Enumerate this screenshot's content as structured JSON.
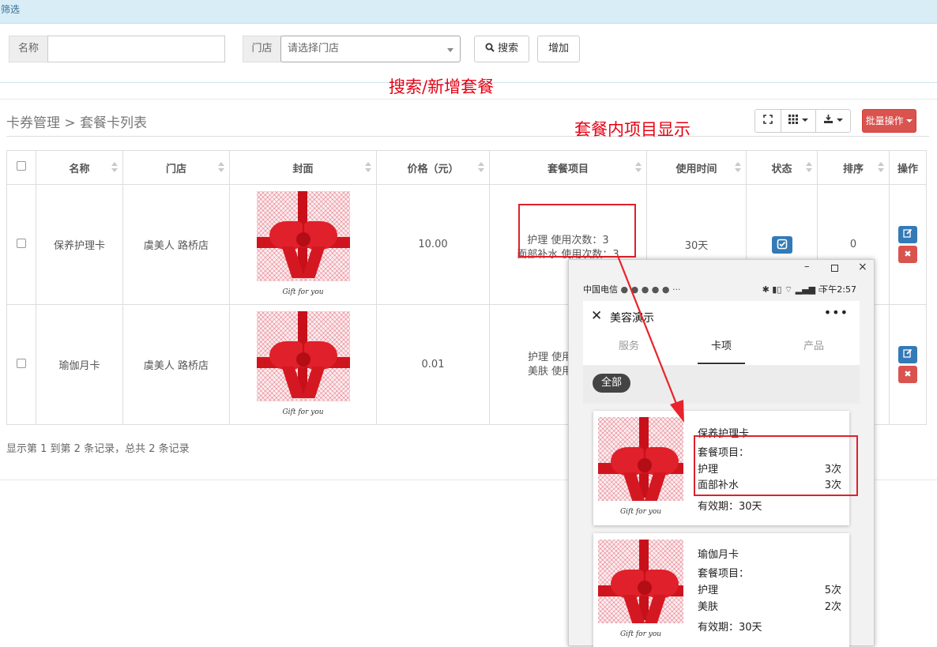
{
  "filter": {
    "title": "筛选",
    "name_label": "名称",
    "name_value": "",
    "store_label": "门店",
    "store_placeholder": "请选择门店",
    "search_label": "搜索",
    "add_label": "增加"
  },
  "annotations": {
    "search_note": "搜索/新增套餐",
    "items_note": "套餐内项目显示"
  },
  "breadcrumb": {
    "parent": "卡券管理",
    "separator": ">",
    "current": "套餐卡列表"
  },
  "toolbar": {
    "batch_label": "批量操作"
  },
  "table": {
    "headers": [
      "名称",
      "门店",
      "封面",
      "价格（元）",
      "套餐项目",
      "使用时间",
      "状态",
      "排序",
      "操作"
    ],
    "rows": [
      {
        "name": "保养护理卡",
        "store": "虞美人 路桥店",
        "cover_text": "Gift for you",
        "price": "10.00",
        "items": [
          "护理 使用次数：3",
          "面部补水 使用次数：3"
        ],
        "duration": "30天",
        "status": "checked",
        "sort": "0"
      },
      {
        "name": "瑜伽月卡",
        "store": "虞美人 路桥店",
        "cover_text": "Gift for you",
        "price": "0.01",
        "items": [
          "护理 使用",
          "美肤 使用"
        ],
        "duration": "",
        "status": "",
        "sort": ""
      }
    ],
    "footer": "显示第 1 到第 2 条记录，总共 2 条记录"
  },
  "phone": {
    "carrier": "中国电信",
    "time": "下午2:57",
    "title": "美容演示",
    "tabs": [
      "服务",
      "卡项",
      "产品"
    ],
    "active_tab": "卡项",
    "filter_pill": "全部",
    "cards": [
      {
        "name": "保养护理卡",
        "items_label": "套餐项目：",
        "items": [
          {
            "name": "护理",
            "count": "3次"
          },
          {
            "name": "面部补水",
            "count": "3次"
          }
        ],
        "validity": "有效期：30天",
        "cover_text": "Gift for you"
      },
      {
        "name": "瑜伽月卡",
        "items_label": "套餐项目：",
        "items": [
          {
            "name": "护理",
            "count": "5次"
          },
          {
            "name": "美肤",
            "count": "2次"
          }
        ],
        "validity": "有效期：30天",
        "cover_text": "Gift for you"
      }
    ]
  },
  "colors": {
    "accent_red": "#e60012",
    "primary_blue": "#337ab7",
    "danger": "#d9534f",
    "info_bg": "#d9edf7"
  }
}
